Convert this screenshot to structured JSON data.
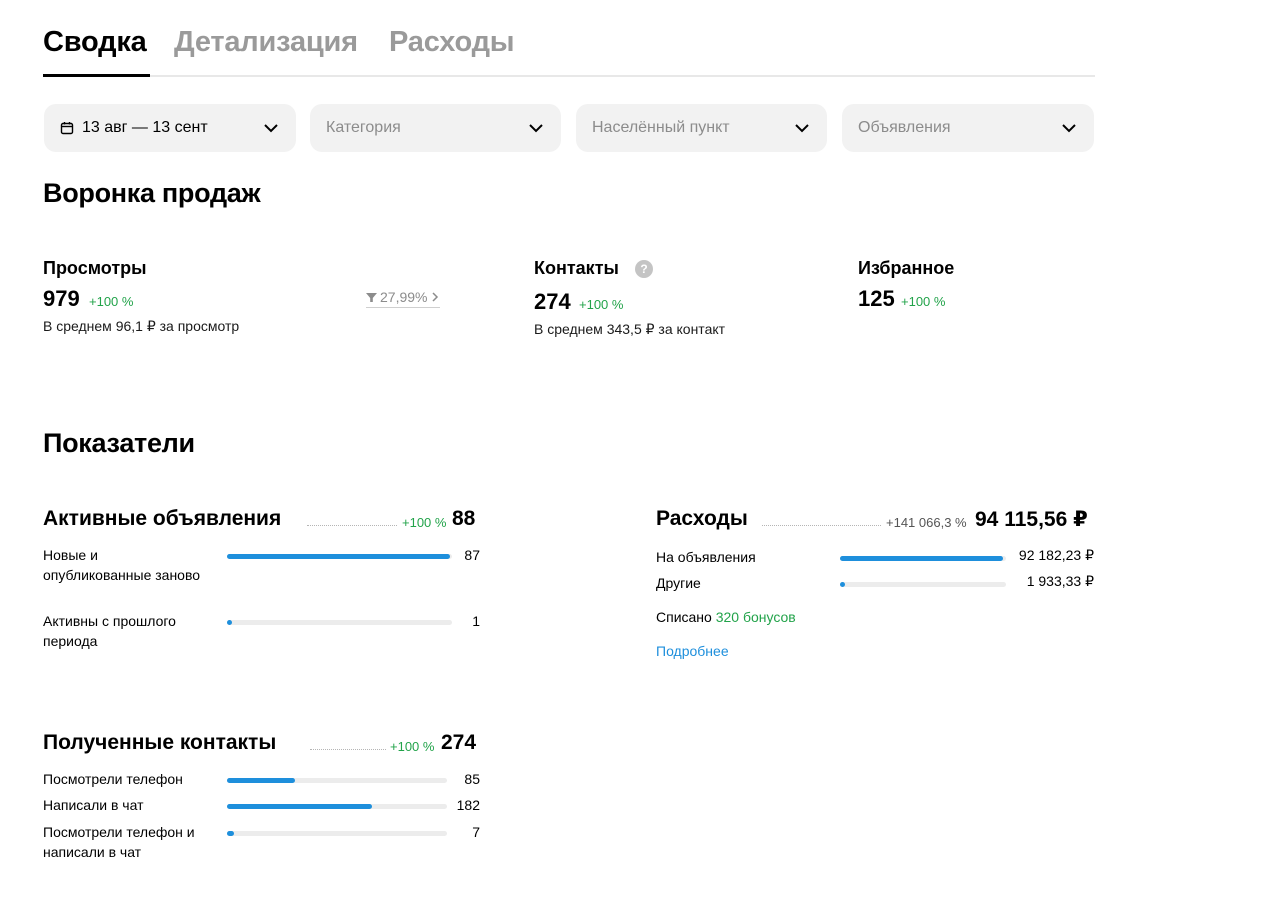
{
  "tabs": [
    {
      "label": "Сводка",
      "active": true
    },
    {
      "label": "Детализация",
      "active": false
    },
    {
      "label": "Расходы",
      "active": false
    }
  ],
  "filters": {
    "date": "13 авг — 13 сент",
    "category": "Категория",
    "location": "Населённый пункт",
    "listings": "Объявления"
  },
  "funnel": {
    "title": "Воронка продаж",
    "views": {
      "title": "Просмотры",
      "value": "979",
      "delta": "+100 %",
      "avg": "В среднем 96,1 ₽ за просмотр",
      "conversion": "27,99%"
    },
    "contacts": {
      "title": "Контакты",
      "help": "?",
      "value": "274",
      "delta": "+100 %",
      "avg": "В среднем 343,5 ₽ за контакт"
    },
    "favorites": {
      "title": "Избранное",
      "value": "125",
      "delta": "+100 %"
    }
  },
  "indicators": {
    "title": "Показатели",
    "active_listings": {
      "title": "Активные объявления",
      "delta": "+100 %",
      "value": "88",
      "rows": [
        {
          "label": "Новые и опубликованные заново",
          "value": "87",
          "ratio": 0.99
        },
        {
          "label": "Активны с прошлого периода",
          "value": "1",
          "ratio": 0.02
        }
      ]
    },
    "expenses": {
      "title": "Расходы",
      "delta": "+141 066,3 %",
      "value": "94 115,56 ₽",
      "rows": [
        {
          "label": "На объявления",
          "value": "92 182,23 ₽",
          "ratio": 0.98
        },
        {
          "label": "Другие",
          "value": "1 933,33 ₽",
          "ratio": 0.03
        }
      ],
      "written_off_label": "Списано",
      "written_off_bonus": "320 бонусов",
      "more_link": "Подробнее"
    },
    "received_contacts": {
      "title": "Полученные контакты",
      "delta": "+100 %",
      "value": "274",
      "rows": [
        {
          "label": "Посмотрели телефон",
          "value": "85",
          "ratio": 0.31
        },
        {
          "label": "Написали в чат",
          "value": "182",
          "ratio": 0.66
        },
        {
          "label": "Посмотрели телефон и написали в чат",
          "value": "7",
          "ratio": 0.03
        }
      ]
    }
  },
  "colors": {
    "accent": "#1e8fdc",
    "positive": "#22a34a"
  }
}
